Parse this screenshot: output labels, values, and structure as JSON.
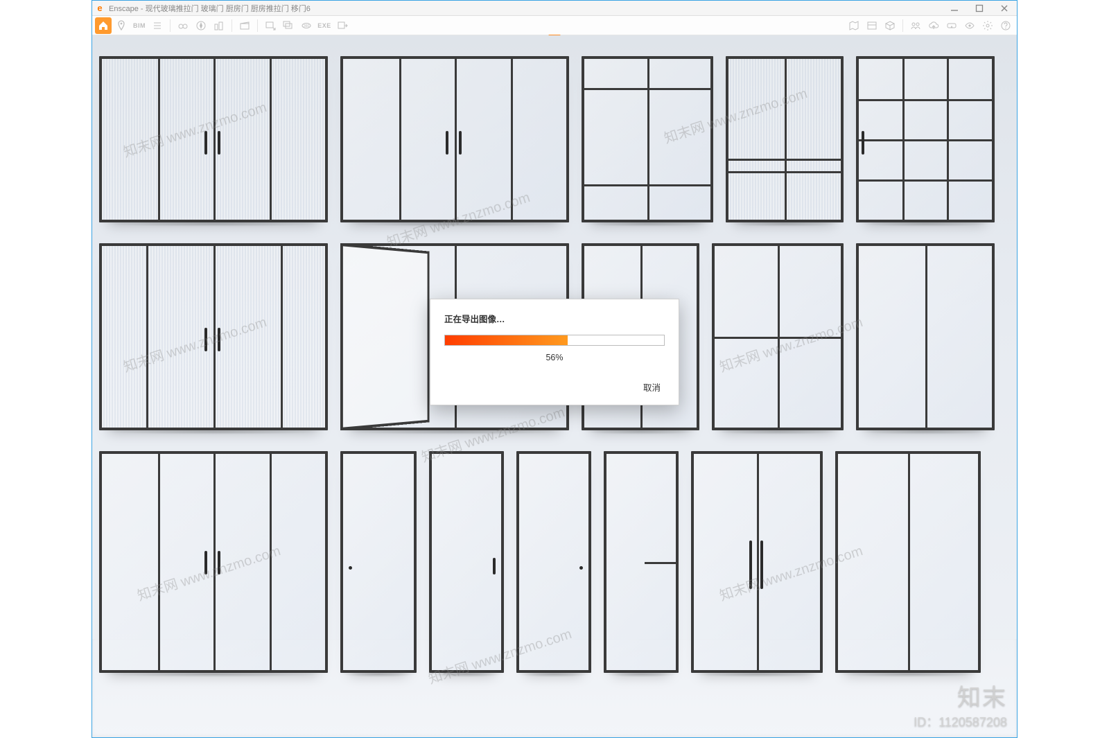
{
  "window": {
    "app_name": "Enscape",
    "title": "Enscape - 现代玻璃推拉门 玻璃门 厨房门 厨房推拉门 移门6",
    "minimize_tip": "Minimize",
    "maximize_tip": "Maximize",
    "close_tip": "Close"
  },
  "toolbar": {
    "bim_label": "BIM",
    "exe_label": "EXE"
  },
  "dialog": {
    "title": "正在导出图像…",
    "percent_value": 56,
    "percent_label": "56%",
    "cancel_label": "取消"
  },
  "watermark": {
    "repeat_text": "知末网 www.znzmo.com",
    "corner_brand": "知末",
    "corner_id_label": "ID：1120587208"
  }
}
